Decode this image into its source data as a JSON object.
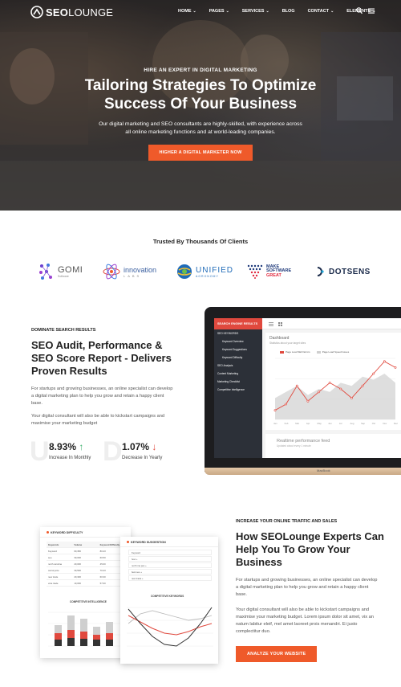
{
  "nav": {
    "logo_bold": "SEO",
    "logo_light": "LOUNGE",
    "menu": [
      {
        "label": "HOME",
        "dropdown": true
      },
      {
        "label": "PAGES",
        "dropdown": true
      },
      {
        "label": "SERVICES",
        "dropdown": true
      },
      {
        "label": "BLOG",
        "dropdown": false
      },
      {
        "label": "CONTACT",
        "dropdown": true
      },
      {
        "label": "ELEMENTS",
        "dropdown": true
      }
    ],
    "icons": [
      "search-icon",
      "hamburger-menu-icon"
    ]
  },
  "hero": {
    "eyebrow": "HIRE AN EXPERT IN DIGITAL MARKETING",
    "title_line1": "Tailoring Strategies To Optimize",
    "title_line2": "Success Of Your Business",
    "desc": "Our digital marketing and SEO consultants are highly-skilled, with experience across all online marketing functions and at world-leading companies.",
    "button": "HIGHER A DIGITAL MARKETER NOW"
  },
  "trusted": {
    "title": "Trusted By Thousands Of Clients",
    "brands": [
      {
        "name": "GOMI",
        "sub": "Software"
      },
      {
        "name": "innovation",
        "sub": "LABS"
      },
      {
        "name": "UNIFIED",
        "sub": "AGRONOMY"
      },
      {
        "name_line1": "MAKE",
        "name_line2": "SOFTWARE",
        "name_line3": "GREAT"
      },
      {
        "name": "DOTSENS"
      }
    ]
  },
  "seo_audit": {
    "eyebrow": "DOMINATE SEARCH RESULTS",
    "title": "SEO Audit, Performance & SEO Score Report - Delivers Proven Results",
    "p1": "For startups and growing businesses, an online specialist can develop a digital marketing plan to help you grow and retain a happy client base.",
    "p2": "Your digital consultant will also be able to kickstart campaigns and maximise your marketing budget",
    "stats": [
      {
        "letter": "U",
        "value": "8.93%",
        "arrow": "↑",
        "label": "Increase In Monthly"
      },
      {
        "letter": "D",
        "value": "1.07%",
        "arrow": "↓",
        "label": "Decrease In Yearly"
      }
    ],
    "dashboard": {
      "sidebar_title": "SEARCH ENGINE RESULTS",
      "sidebar_items": [
        {
          "label": "SEO KEYWORDS",
          "sub": false
        },
        {
          "label": "Keyword Overview",
          "sub": true
        },
        {
          "label": "Keyword Suggestions",
          "sub": true
        },
        {
          "label": "Keyword Difficulty",
          "sub": true
        },
        {
          "label": "SEO Analysis",
          "sub": false
        },
        {
          "label": "Content Marketing",
          "sub": false
        },
        {
          "label": "Marketing Checklist",
          "sub": false
        },
        {
          "label": "Competitive Intelligence",
          "sub": false
        }
      ],
      "card_title": "Dashboard",
      "card_sub": "Statistics about your target sites",
      "legend": [
        "Page Load SEO Errors",
        "Page Load Speed Issues"
      ],
      "chart_months": [
        "Jan",
        "Feb",
        "Mar",
        "Apr",
        "May",
        "Jun",
        "Jul",
        "Aug",
        "Sep",
        "Oct",
        "Nov",
        "Dec"
      ],
      "card2_title": "Realtime performance feed",
      "card2_sub": "Updated about every 1 minute",
      "laptop_brand": "MacBook"
    }
  },
  "traffic": {
    "eyebrow": "INCREASE YOUR ONLINE TRAFFIC AND SALES",
    "title": "How SEOLounge Experts Can Help You To Grow Your Business",
    "p1": "For startups and growing businesses, an online specialist can develop a digital marketing plan to help you grow and retain a happy client base.",
    "p2": "Your digital consultant will also be able to kickstart campaigns and maximise your marketing budget. Lorem ipsum dolor sit amet, vix an natum labitur eleif, mel amet laoreet prois menandri. Ei justo complectitur duo.",
    "button": "ANALYZE YOUR WEBSITE",
    "mock_kd": {
      "title": "KEYWORD DIFFICULTY",
      "headers": [
        "Keywords",
        "Volume",
        "Keyword Difficulty"
      ],
      "rows": [
        [
          "Keyword",
          "60,350",
          "80.43"
        ],
        [
          "seo",
          "30,000",
          "60.50"
        ],
        [
          "north carolina",
          "20,000",
          "45.00"
        ],
        [
          "carrot juice",
          "30,500",
          "70.43"
        ],
        [
          "new trade",
          "20,300",
          "60.30"
        ],
        [
          "vote trade",
          "10,000",
          "57.00"
        ]
      ],
      "chart_title": "COMPETITIVE INTELLIGENCE"
    },
    "mock_ks": {
      "title": "KEYWORD SUGGESTION",
      "items": [
        "Keyword",
        "how +",
        "north ma pos +",
        "best seo +",
        "new trade +"
      ],
      "chart_title": "COMPETITIVE KEYWORDS"
    }
  },
  "colors": {
    "accent": "#ef5a2a",
    "dark_sidebar": "#2c3038",
    "dashboard_header": "#e0493e",
    "up": "#3bb06b",
    "down": "#e0493e"
  }
}
